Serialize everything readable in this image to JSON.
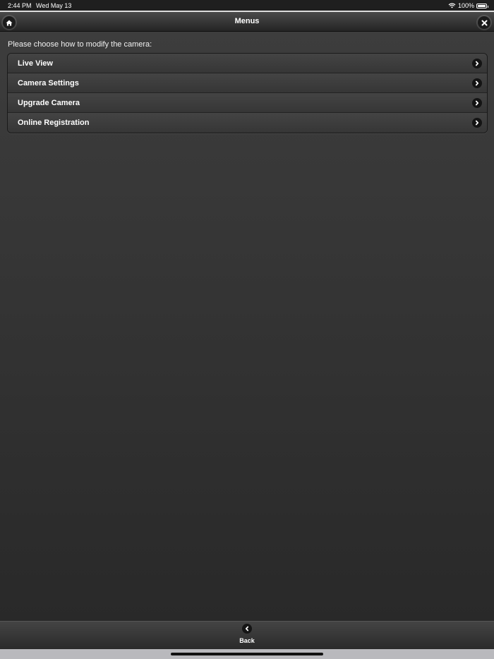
{
  "status_bar": {
    "time": "2:44 PM",
    "date": "Wed May 13",
    "battery_percent": "100%",
    "wifi_icon": "wifi-icon",
    "battery_icon": "battery-icon"
  },
  "header": {
    "title": "Menus",
    "home_icon": "home-icon",
    "close_icon": "close-icon"
  },
  "main": {
    "prompt": "Please choose how to modify the camera:",
    "menu_items": [
      {
        "label": "Live View",
        "icon": "chevron-right-icon"
      },
      {
        "label": "Camera Settings",
        "icon": "chevron-right-icon"
      },
      {
        "label": "Upgrade Camera",
        "icon": "chevron-right-icon"
      },
      {
        "label": "Online Registration",
        "icon": "chevron-right-icon"
      }
    ]
  },
  "footer": {
    "back_label": "Back",
    "back_icon": "chevron-left-icon"
  },
  "colors": {
    "background_top": "#3d3d3d",
    "background_bottom": "#292929",
    "text": "#ffffff"
  }
}
